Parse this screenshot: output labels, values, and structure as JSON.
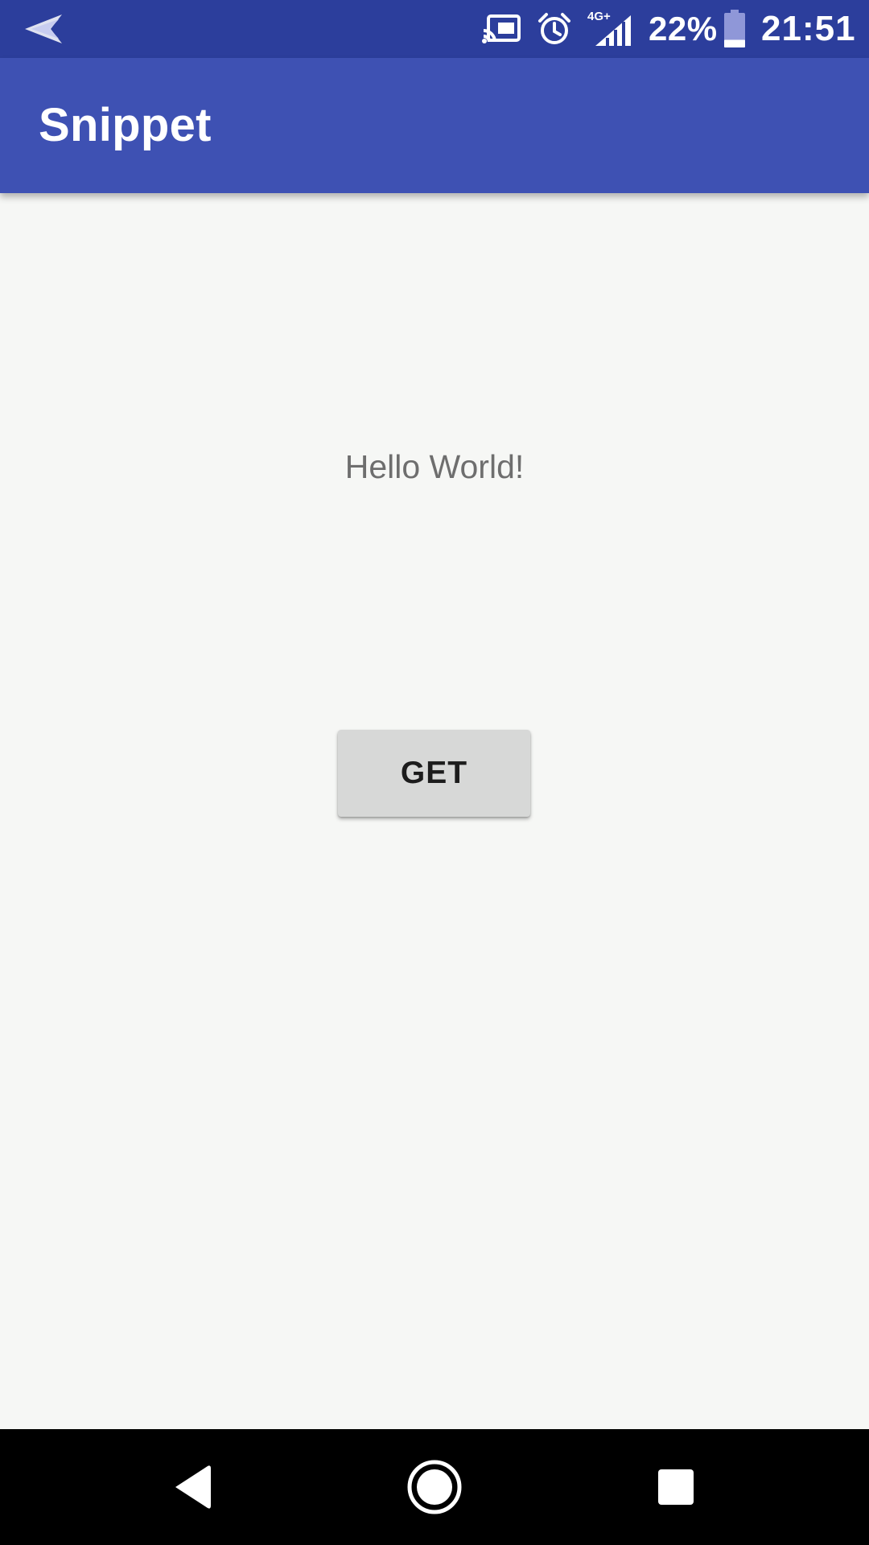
{
  "status_bar": {
    "battery_percent": "22%",
    "time": "21:51",
    "network_type": "4G+",
    "battery_level": 0.22,
    "icons": [
      "send-icon",
      "cast-icon",
      "alarm-icon",
      "signal-icon",
      "battery-icon"
    ]
  },
  "app_bar": {
    "title": "Snippet"
  },
  "main": {
    "hello_text": "Hello World!",
    "get_button_label": "GET"
  },
  "nav_bar": {
    "icons": [
      "back-icon",
      "home-icon",
      "recents-icon"
    ]
  },
  "colors": {
    "status_bar": "#2c3e9c",
    "app_bar": "#3e51b3",
    "background": "#f6f7f5",
    "button": "#d7d8d7",
    "nav_bar": "#000000"
  }
}
